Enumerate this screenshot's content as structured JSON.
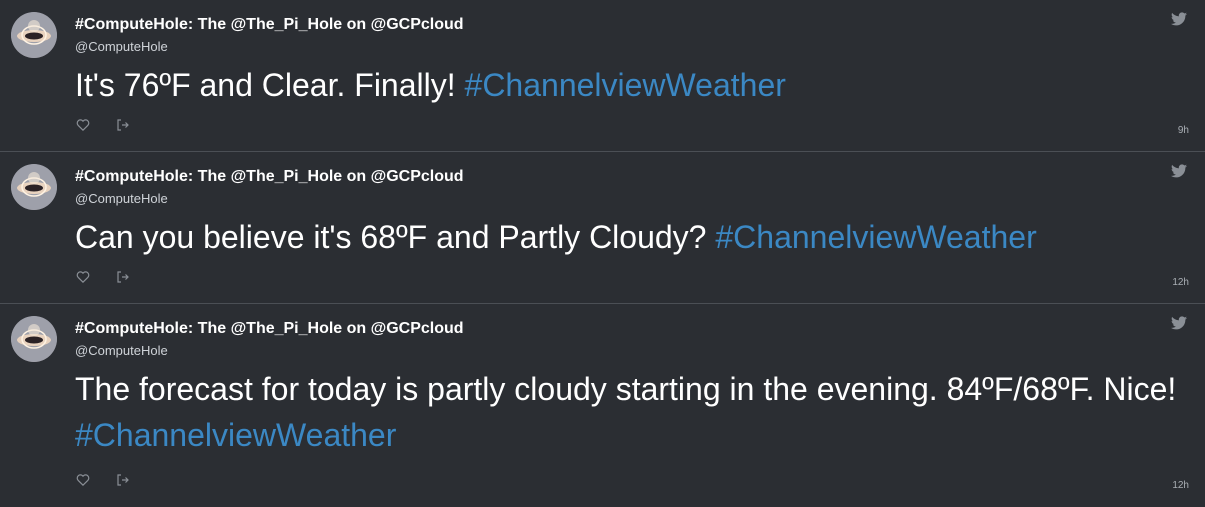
{
  "colors": {
    "background": "#2b2e33",
    "divider": "#4b4f55",
    "hashtag": "#3b88c4",
    "text": "#ffffff",
    "meta": "#a9aeb4"
  },
  "icons": {
    "brand": "twitter-bird-icon",
    "like": "heart-icon",
    "share": "share-icon",
    "avatar": "compute-hole-avatar"
  },
  "tweets": [
    {
      "name": "#ComputeHole: The @The_Pi_Hole on @GCPcloud",
      "handle": "@ComputeHole",
      "text": "It's 76ºF and Clear. Finally! ",
      "hashtag": "#ChannelviewWeather",
      "time": "9h"
    },
    {
      "name": "#ComputeHole: The @The_Pi_Hole on @GCPcloud",
      "handle": "@ComputeHole",
      "text": "Can you believe it's 68ºF and Partly Cloudy? ",
      "hashtag": "#ChannelviewWeather",
      "time": "12h"
    },
    {
      "name": "#ComputeHole: The @The_Pi_Hole on @GCPcloud",
      "handle": "@ComputeHole",
      "text": "The forecast for today is partly cloudy starting in the evening. 84ºF/68ºF. Nice! ",
      "hashtag": "#ChannelviewWeather",
      "time": "12h"
    }
  ]
}
